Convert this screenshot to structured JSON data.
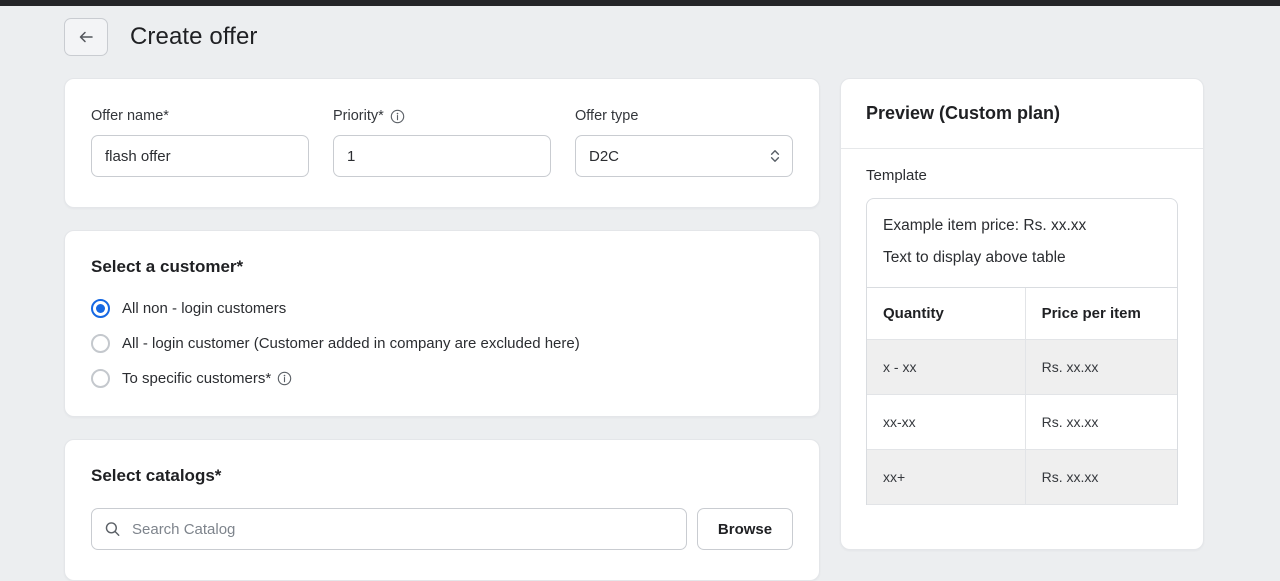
{
  "topbar": {
    "color": "#242528"
  },
  "header": {
    "back_icon": "arrow-left-icon",
    "title": "Create offer"
  },
  "form": {
    "offer_name": {
      "label": "Offer name*",
      "value": "flash offer",
      "placeholder": "Offer name"
    },
    "priority": {
      "label": "Priority*",
      "info_icon": "info-icon",
      "value": "1",
      "placeholder": "Priority"
    },
    "offer_type": {
      "label": "Offer type",
      "value": "D2C",
      "caret_icon": "chevron-up-down-icon",
      "options": [
        "D2C"
      ]
    }
  },
  "customer": {
    "title": "Select a customer*",
    "selected_index": 0,
    "options": [
      {
        "label": "All non - login customers",
        "checked": true,
        "info_icon": null
      },
      {
        "label": "All - login customer (Customer added in company are excluded here)",
        "checked": false,
        "info_icon": null
      },
      {
        "label": "To specific customers*",
        "checked": false,
        "info_icon": "info-icon"
      }
    ]
  },
  "catalogs": {
    "title": "Select catalogs*",
    "search_icon": "search-icon",
    "search_value": "",
    "search_placeholder": "Search Catalog",
    "browse_label": "Browse"
  },
  "preview": {
    "title": "Preview (Custom plan)",
    "template_label": "Template",
    "template_lines": [
      "Example item price: Rs. xx.xx",
      "Text to display above table"
    ],
    "table": {
      "headers": [
        "Quantity",
        "Price per item"
      ],
      "rows": [
        [
          "x - xx",
          "Rs. xx.xx"
        ],
        [
          "xx-xx",
          "Rs. xx.xx"
        ],
        [
          "xx+",
          "Rs. xx.xx"
        ]
      ]
    }
  },
  "colors": {
    "accent": "#1668e3",
    "page_bg": "#eceef0",
    "card_bg": "#ffffff",
    "border": "#c9ccd1",
    "topbar": "#242528"
  }
}
